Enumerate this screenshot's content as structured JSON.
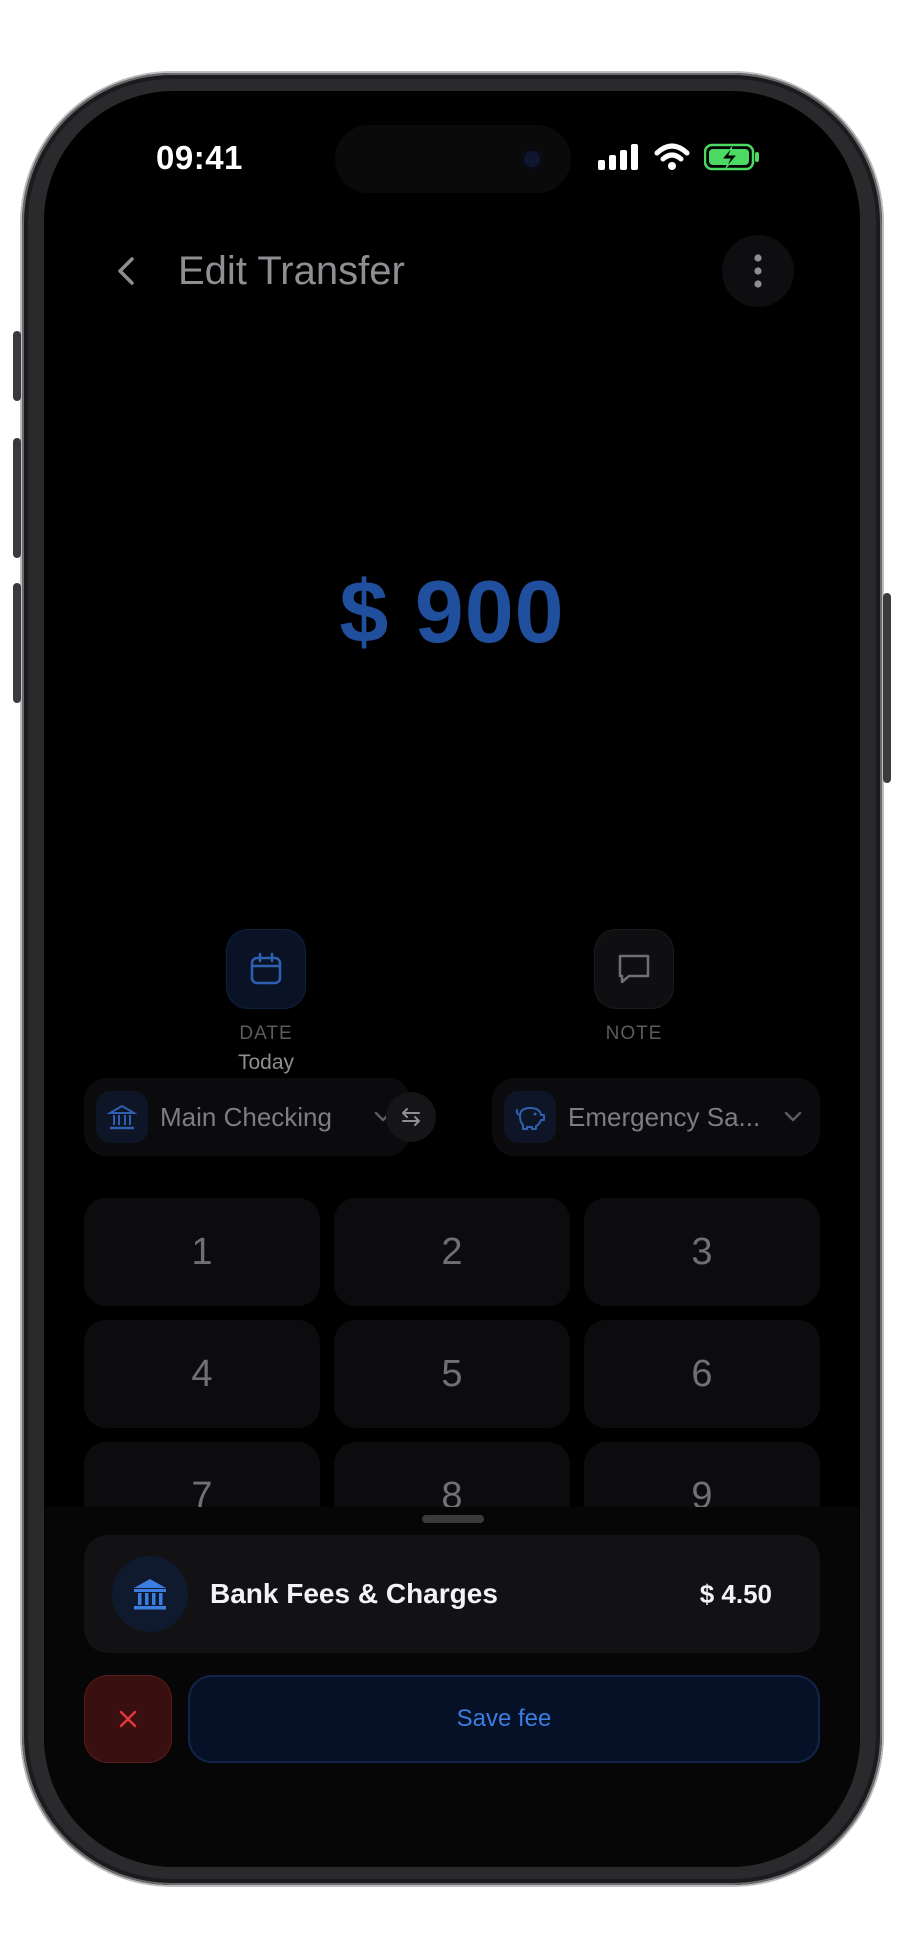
{
  "status_bar": {
    "time": "09:41"
  },
  "header": {
    "title": "Edit Transfer",
    "back_icon": "chevron-left-icon",
    "more_icon": "more-vertical-icon"
  },
  "amount": {
    "display": "$ 900",
    "color": "#204f9e"
  },
  "options": [
    {
      "id": "date",
      "icon": "calendar-icon",
      "label": "DATE",
      "value": "Today"
    },
    {
      "id": "note",
      "icon": "message-square-icon",
      "label": "NOTE",
      "value": ""
    }
  ],
  "accounts": {
    "from": {
      "icon": "bank-icon",
      "name": "Main Checking"
    },
    "swap_icon": "swap-arrows-icon",
    "to": {
      "icon": "piggy-bank-icon",
      "name": "Emergency Sa..."
    }
  },
  "keypad": {
    "keys": [
      "1",
      "2",
      "3",
      "4",
      "5",
      "6",
      "7",
      "8",
      "9"
    ]
  },
  "fee_sheet": {
    "category": {
      "icon": "bank-icon",
      "name": "Bank Fees & Charges",
      "amount": "$ 4.50"
    },
    "cancel_icon": "close-icon",
    "save_label": "Save fee",
    "accent": "#3b7de0",
    "danger": "#e0393b"
  }
}
